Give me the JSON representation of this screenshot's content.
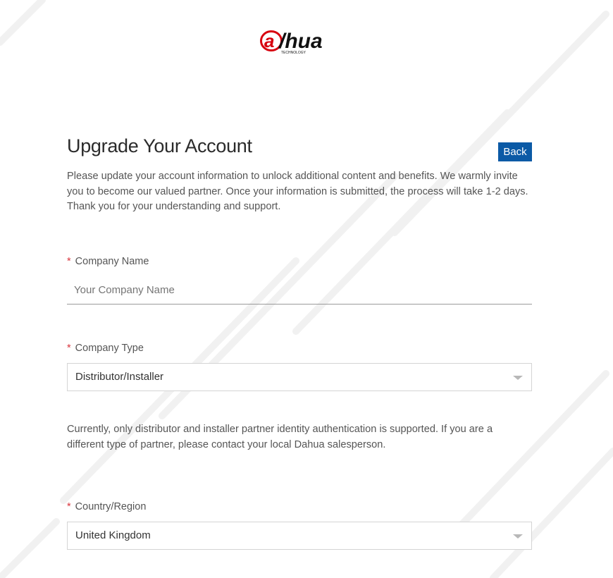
{
  "brand": {
    "logo_text": "alhua",
    "logo_subtext": "TECHNOLOGY",
    "accent_color": "#d7000f"
  },
  "page": {
    "title": "Upgrade Your Account",
    "back_label": "Back",
    "intro": "Please update your account information to unlock additional content and benefits. We warmly invite you to become our valued partner. Once your information is submitted, the process will take 1-2 days. Thank you for your understanding and support."
  },
  "form": {
    "required_marker": "*",
    "company_name": {
      "label": "Company Name",
      "placeholder": "Your Company Name",
      "value": ""
    },
    "company_type": {
      "label": "Company Type",
      "selected": "Distributor/Installer"
    },
    "company_type_note": "Currently, only distributor and installer partner identity authentication is supported. If you are a different type of partner, please contact your local Dahua salesperson.",
    "country_region": {
      "label": "Country/Region",
      "selected": "United Kingdom"
    }
  },
  "colors": {
    "primary_button": "#0b5aa6",
    "required": "#d9363e",
    "text": "#333333"
  }
}
